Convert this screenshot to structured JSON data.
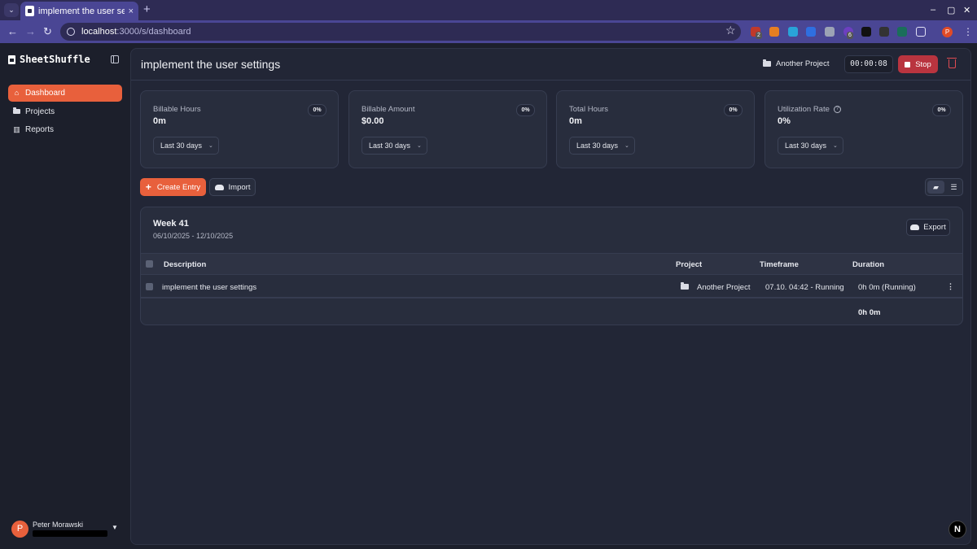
{
  "browser": {
    "tab_title": "implement the user settings",
    "tab_close": "×",
    "new_tab": "+",
    "menu": "⌄",
    "url_host": "localhost",
    "url_path": ":3000/s/dashboard",
    "extension_badges": [
      "2",
      "6"
    ],
    "profile_initial": "P",
    "win_minimize": "–",
    "win_maximize": "▢",
    "win_close": "✕"
  },
  "sidebar": {
    "brand": "SheetShuffle",
    "items": [
      {
        "label": "Dashboard",
        "icon": "home-icon",
        "active": true
      },
      {
        "label": "Projects",
        "icon": "folder-icon",
        "active": false
      },
      {
        "label": "Reports",
        "icon": "bar-chart-icon",
        "active": false
      }
    ],
    "user": {
      "initial": "P",
      "name": "Peter Morawski"
    }
  },
  "header": {
    "title": "implement the user settings",
    "project": "Another Project",
    "timer": "00:00:08",
    "stop_label": "Stop"
  },
  "stats": [
    {
      "label": "Billable Hours",
      "value": "0m",
      "badge": "0%",
      "range": "Last 30 days"
    },
    {
      "label": "Billable Amount",
      "value": "$0.00",
      "badge": "0%",
      "range": "Last 30 days"
    },
    {
      "label": "Total Hours",
      "value": "0m",
      "badge": "0%",
      "range": "Last 30 days"
    },
    {
      "label": "Utilization Rate",
      "value": "0%",
      "badge": "0%",
      "range": "Last 30 days"
    }
  ],
  "actions": {
    "create_label": "Create Entry",
    "import_label": "Import"
  },
  "week": {
    "title": "Week 41",
    "range": "06/10/2025 - 12/10/2025",
    "export_label": "Export",
    "columns": [
      "Description",
      "Project",
      "Timeframe",
      "Duration"
    ],
    "rows": [
      {
        "description": "implement the user settings",
        "project": "Another Project",
        "timeframe": "07.10. 04:42 - Running",
        "duration": "0h 0m (Running)"
      }
    ],
    "total": "0h 0m"
  },
  "colors": {
    "accent": "#e8603c",
    "stop": "#b9343f",
    "browser": "#4a4694"
  },
  "dev_badge": "N"
}
